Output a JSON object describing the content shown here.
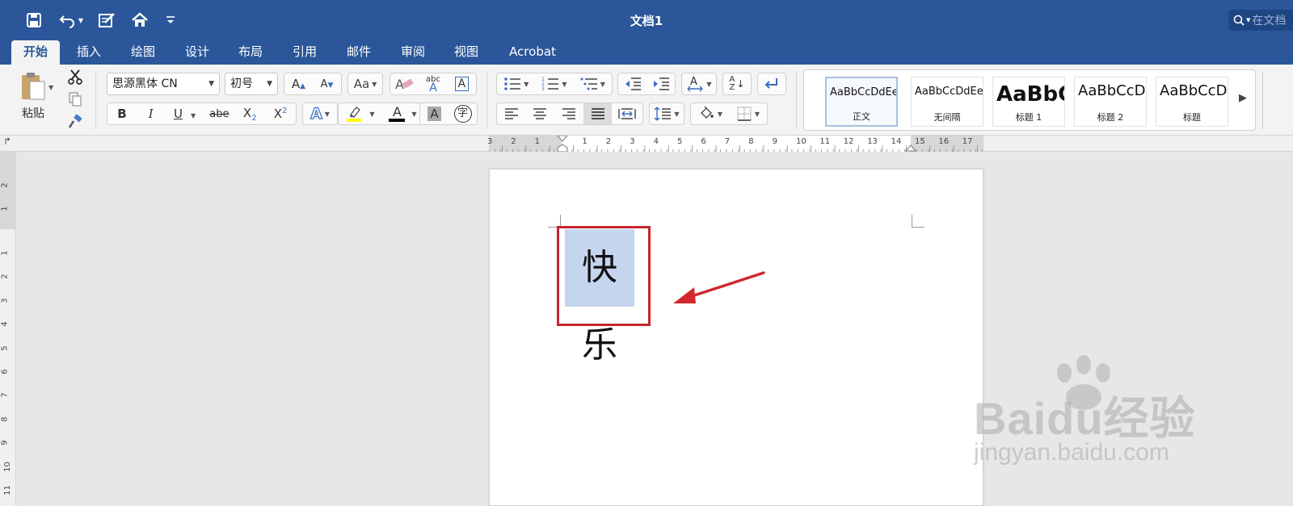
{
  "window": {
    "title": "文档1"
  },
  "search": {
    "placeholder": "在文档"
  },
  "tabs": [
    "开始",
    "插入",
    "绘图",
    "设计",
    "布局",
    "引用",
    "邮件",
    "审阅",
    "视图",
    "Acrobat"
  ],
  "clipboard": {
    "paste_label": "粘贴"
  },
  "font": {
    "family": "思源黑体 CN",
    "size": "初号",
    "grow_label": "A",
    "shrink_label": "A",
    "case_label": "Aa",
    "phonetic_label": "abc",
    "phonetic_sub": "A",
    "border_label": "A",
    "bold": "B",
    "italic": "I",
    "underline": "U",
    "strike": "abe",
    "subscript": "X",
    "subscript_mark": "2",
    "superscript": "X",
    "superscript_mark": "2",
    "effects_label": "A",
    "color_label": "A",
    "shading_label": "A",
    "enclose_label": "字",
    "highlight_color": "#ffff00",
    "font_color": "#000000"
  },
  "paragraph": {
    "sort_a": "A",
    "sort_z": "Z"
  },
  "styles": [
    {
      "sample": "AaBbCcDdEe",
      "name": "正文"
    },
    {
      "sample": "AaBbCcDdEe",
      "name": "无间隔"
    },
    {
      "sample": "AaBbC",
      "name": "标题 1"
    },
    {
      "sample": "AaBbCcD",
      "name": "标题 2"
    },
    {
      "sample": "AaBbCcD",
      "name": "标题"
    }
  ],
  "ruler": {
    "h_left": [
      "3",
      "2",
      "1"
    ],
    "h_right": [
      "1",
      "2",
      "3",
      "4",
      "5",
      "6",
      "7",
      "8",
      "9",
      "10",
      "11",
      "12",
      "13",
      "14",
      "15",
      "16",
      "17"
    ],
    "v_top": [
      "2",
      "1"
    ],
    "v_bottom": [
      "1",
      "2",
      "3",
      "4",
      "5",
      "6",
      "7",
      "8",
      "9",
      "10",
      "11"
    ]
  },
  "document": {
    "selected_text": "快乐"
  },
  "watermark": {
    "brand": "Baidu经验",
    "url": "jingyan.baidu.com"
  },
  "colors": {
    "ribbon_blue": "#2b579a",
    "selection": "#c5d5ee",
    "annotation_red": "#c4262e"
  }
}
